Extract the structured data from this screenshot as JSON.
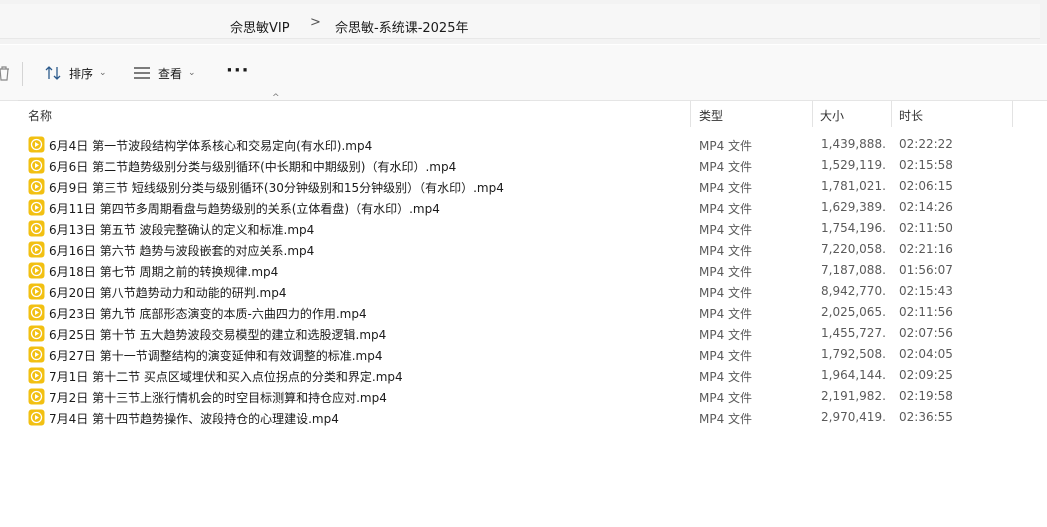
{
  "breadcrumb": {
    "items": [
      "佘思敏VIP",
      "佘思敏-系统课-2025年"
    ],
    "separator": ">"
  },
  "toolbar": {
    "sort_label": "排序",
    "view_label": "查看",
    "more_label": "···"
  },
  "columns": {
    "name": "名称",
    "type": "类型",
    "size": "大小",
    "duration": "时长"
  },
  "colors": {
    "icon_fill": "#f2c012",
    "icon_play": "#ffffff",
    "accent": "#f2c012"
  },
  "files": [
    {
      "name": "6月4日 第一节波段结构学体系核心和交易定向(有水印).mp4",
      "type": "MP4 文件",
      "size": "1,439,888...",
      "duration": "02:22:22"
    },
    {
      "name": "6月6日 第二节趋势级别分类与级别循环(中长期和中期级别)（有水印）.mp4",
      "type": "MP4 文件",
      "size": "1,529,119...",
      "duration": "02:15:58"
    },
    {
      "name": "6月9日 第三节 短线级别分类与级别循环(30分钟级别和15分钟级别）（有水印）.mp4",
      "type": "MP4 文件",
      "size": "1,781,021...",
      "duration": "02:06:15"
    },
    {
      "name": "6月11日 第四节多周期看盘与趋势级别的关系(立体看盘)（有水印）.mp4",
      "type": "MP4 文件",
      "size": "1,629,389...",
      "duration": "02:14:26"
    },
    {
      "name": "6月13日 第五节 波段完整确认的定义和标准.mp4",
      "type": "MP4 文件",
      "size": "1,754,196...",
      "duration": "02:11:50"
    },
    {
      "name": "6月16日 第六节 趋势与波段嵌套的对应关系.mp4",
      "type": "MP4 文件",
      "size": "7,220,058...",
      "duration": "02:21:16"
    },
    {
      "name": "6月18日 第七节 周期之前的转换规律.mp4",
      "type": "MP4 文件",
      "size": "7,187,088...",
      "duration": "01:56:07"
    },
    {
      "name": "6月20日 第八节趋势动力和动能的研判.mp4",
      "type": "MP4 文件",
      "size": "8,942,770...",
      "duration": "02:15:43"
    },
    {
      "name": "6月23日 第九节 底部形态演变的本质-六曲四力的作用.mp4",
      "type": "MP4 文件",
      "size": "2,025,065...",
      "duration": "02:11:56"
    },
    {
      "name": "6月25日 第十节 五大趋势波段交易模型的建立和选股逻辑.mp4",
      "type": "MP4 文件",
      "size": "1,455,727...",
      "duration": "02:07:56"
    },
    {
      "name": "6月27日 第十一节调整结构的演变延伸和有效调整的标准.mp4",
      "type": "MP4 文件",
      "size": "1,792,508...",
      "duration": "02:04:05"
    },
    {
      "name": "7月1日 第十二节 买点区域埋伏和买入点位拐点的分类和界定.mp4",
      "type": "MP4 文件",
      "size": "1,964,144...",
      "duration": "02:09:25"
    },
    {
      "name": "7月2日 第十三节上涨行情机会的时空目标测算和持仓应对.mp4",
      "type": "MP4 文件",
      "size": "2,191,982...",
      "duration": "02:19:58"
    },
    {
      "name": "7月4日 第十四节趋势操作、波段持仓的心理建设.mp4",
      "type": "MP4 文件",
      "size": "2,970,419...",
      "duration": "02:36:55"
    }
  ]
}
